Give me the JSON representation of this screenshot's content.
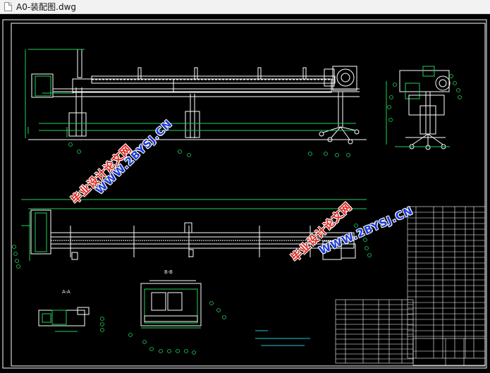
{
  "window": {
    "title": "A0-装配图.dwg"
  },
  "drawing": {
    "section_a_label": "A-A",
    "section_b_label": "B-B",
    "colors": {
      "background": "#000000",
      "outline": "#ffffff",
      "dimension": "#1fd15a",
      "note": "#18c9d0"
    }
  },
  "watermarks": {
    "site": "WWW.2BYSJ.CN",
    "cn": "毕业设计论文网"
  }
}
